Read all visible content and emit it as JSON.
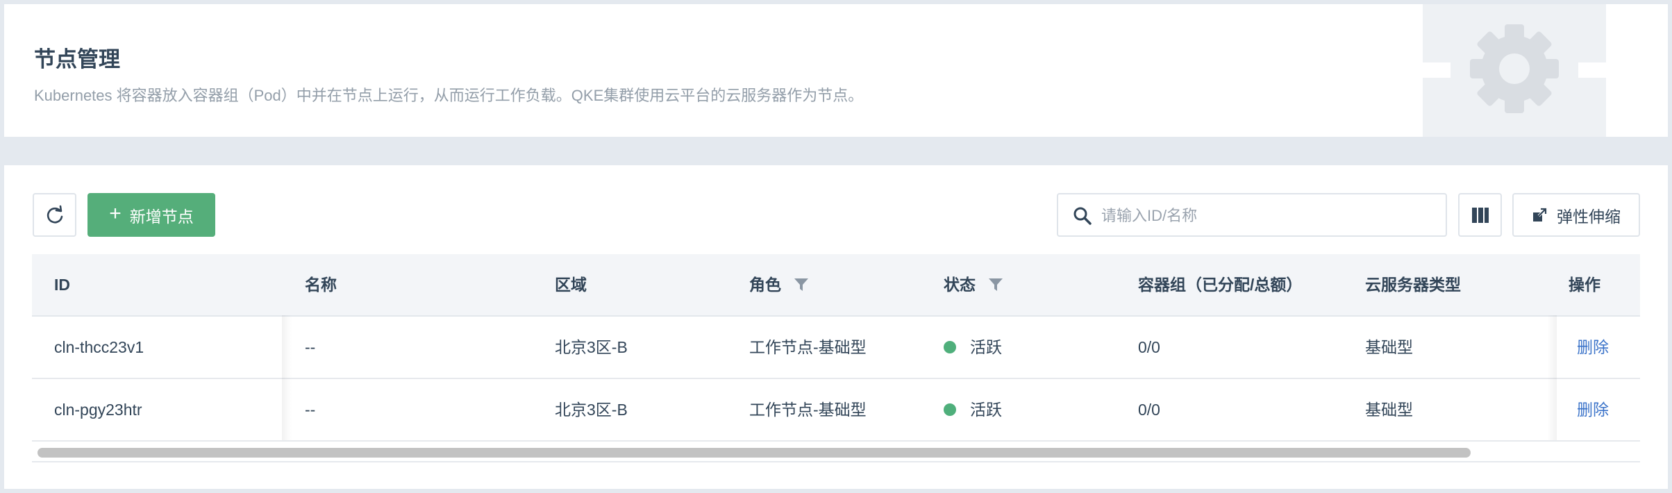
{
  "header": {
    "title": "节点管理",
    "description": "Kubernetes 将容器放入容器组（Pod）中并在节点上运行，从而运行工作负载。QKE集群使用云平台的云服务器作为节点。",
    "illustration_icon": "gear-icon"
  },
  "toolbar": {
    "refresh_icon": "refresh-icon",
    "add_label": "新增节点",
    "search_placeholder": "请输入ID/名称",
    "search_value": "",
    "columns_icon": "columns-icon",
    "scale_label": "弹性伸缩"
  },
  "table": {
    "columns": [
      "ID",
      "名称",
      "区域",
      "角色",
      "状态",
      "容器组（已分配/总额）",
      "云服务器类型",
      "操作"
    ],
    "rows": [
      {
        "id": "cln-thcc23v1",
        "name": "--",
        "zone": "北京3区-B",
        "role": "工作节点-基础型",
        "status": "活跃",
        "pods": "0/0",
        "type": "基础型",
        "action": "删除"
      },
      {
        "id": "cln-pgy23htr",
        "name": "--",
        "zone": "北京3区-B",
        "role": "工作节点-基础型",
        "status": "活跃",
        "pods": "0/0",
        "type": "基础型",
        "action": "删除"
      }
    ]
  },
  "colors": {
    "primary_green": "#55ae7a",
    "status_active": "#4faf7b",
    "link_blue": "#3b73c9",
    "page_bg": "#e4e9ef"
  }
}
